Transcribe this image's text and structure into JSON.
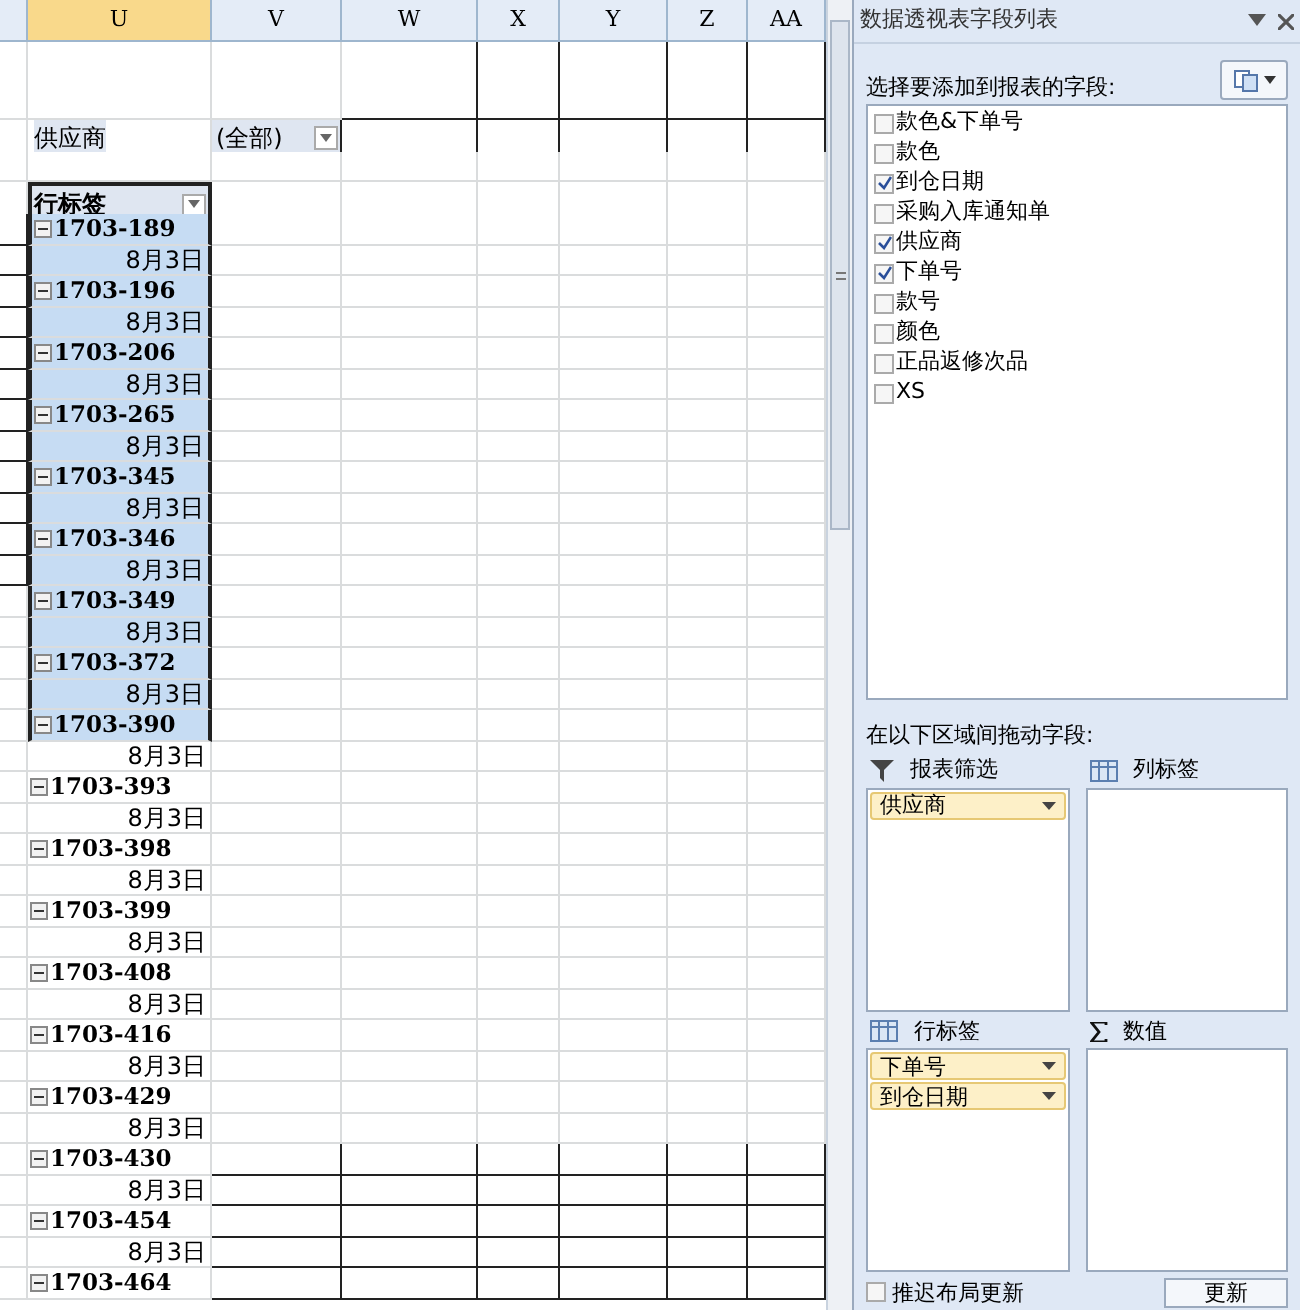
{
  "columns": [
    {
      "label": "U",
      "selected": true
    },
    {
      "label": "V",
      "selected": false
    },
    {
      "label": "W",
      "selected": false
    },
    {
      "label": "X",
      "selected": false
    },
    {
      "label": "Y",
      "selected": false
    },
    {
      "label": "Z",
      "selected": false
    },
    {
      "label": "AA",
      "selected": false
    }
  ],
  "filter": {
    "label": "供应商",
    "value": "(全部)"
  },
  "row_header": "行标签",
  "rows": [
    {
      "kind": "group",
      "label": "1703-189",
      "expanded": true,
      "selected": true
    },
    {
      "kind": "date",
      "label": "8月3日",
      "selected": true
    },
    {
      "kind": "group",
      "label": "1703-196",
      "expanded": true,
      "selected": true
    },
    {
      "kind": "date",
      "label": "8月3日",
      "selected": true
    },
    {
      "kind": "group",
      "label": "1703-206",
      "expanded": true,
      "selected": true
    },
    {
      "kind": "date",
      "label": "8月3日",
      "selected": true
    },
    {
      "kind": "group",
      "label": "1703-265",
      "expanded": true,
      "selected": true
    },
    {
      "kind": "date",
      "label": "8月3日",
      "selected": true
    },
    {
      "kind": "group",
      "label": "1703-345",
      "expanded": true,
      "selected": true
    },
    {
      "kind": "date",
      "label": "8月3日",
      "selected": true
    },
    {
      "kind": "group",
      "label": "1703-346",
      "expanded": true,
      "selected": true
    },
    {
      "kind": "date",
      "label": "8月3日",
      "selected": true
    },
    {
      "kind": "group",
      "label": "1703-349",
      "expanded": true,
      "selected": true
    },
    {
      "kind": "date",
      "label": "8月3日",
      "selected": true
    },
    {
      "kind": "group",
      "label": "1703-372",
      "expanded": true,
      "selected": true
    },
    {
      "kind": "date",
      "label": "8月3日",
      "selected": true
    },
    {
      "kind": "group",
      "label": "1703-390",
      "expanded": true,
      "selected": true
    },
    {
      "kind": "date",
      "label": "8月3日",
      "selected": false
    },
    {
      "kind": "group",
      "label": "1703-393",
      "expanded": true,
      "selected": false
    },
    {
      "kind": "date",
      "label": "8月3日",
      "selected": false
    },
    {
      "kind": "group",
      "label": "1703-398",
      "expanded": true,
      "selected": false
    },
    {
      "kind": "date",
      "label": "8月3日",
      "selected": false
    },
    {
      "kind": "group",
      "label": "1703-399",
      "expanded": true,
      "selected": false
    },
    {
      "kind": "date",
      "label": "8月3日",
      "selected": false
    },
    {
      "kind": "group",
      "label": "1703-408",
      "expanded": true,
      "selected": false
    },
    {
      "kind": "date",
      "label": "8月3日",
      "selected": false
    },
    {
      "kind": "group",
      "label": "1703-416",
      "expanded": true,
      "selected": false
    },
    {
      "kind": "date",
      "label": "8月3日",
      "selected": false
    },
    {
      "kind": "group",
      "label": "1703-429",
      "expanded": true,
      "selected": false
    },
    {
      "kind": "date",
      "label": "8月3日",
      "selected": false
    },
    {
      "kind": "group",
      "label": "1703-430",
      "expanded": true,
      "selected": false
    },
    {
      "kind": "date",
      "label": "8月3日",
      "selected": false
    },
    {
      "kind": "group",
      "label": "1703-454",
      "expanded": true,
      "selected": false
    },
    {
      "kind": "date",
      "label": "8月3日",
      "selected": false
    },
    {
      "kind": "group",
      "label": "1703-464",
      "expanded": true,
      "selected": false
    }
  ],
  "panel": {
    "title": "数据透视表字段列表",
    "field_prompt": "选择要添加到报表的字段:",
    "fields": [
      {
        "label": "款色&下单号",
        "checked": false
      },
      {
        "label": "款色",
        "checked": false
      },
      {
        "label": "到仓日期",
        "checked": true
      },
      {
        "label": "采购入库通知单",
        "checked": false
      },
      {
        "label": "供应商",
        "checked": true
      },
      {
        "label": "下单号",
        "checked": true
      },
      {
        "label": "款号",
        "checked": false
      },
      {
        "label": "颜色",
        "checked": false
      },
      {
        "label": "正品返修次品",
        "checked": false
      },
      {
        "label": "XS",
        "checked": false
      }
    ],
    "area_prompt": "在以下区域间拖动字段:",
    "areas": [
      {
        "kind": "filter",
        "title": "报表筛选",
        "items": [
          "供应商"
        ]
      },
      {
        "kind": "columns",
        "title": "列标签"
      },
      {
        "kind": "rows",
        "title": "行标签",
        "items": [
          "下单号",
          "到仓日期"
        ]
      },
      {
        "kind": "values",
        "title": "数值"
      }
    ],
    "defer": {
      "label": "推迟布局更新",
      "checked": false
    },
    "update_button": "更新"
  }
}
